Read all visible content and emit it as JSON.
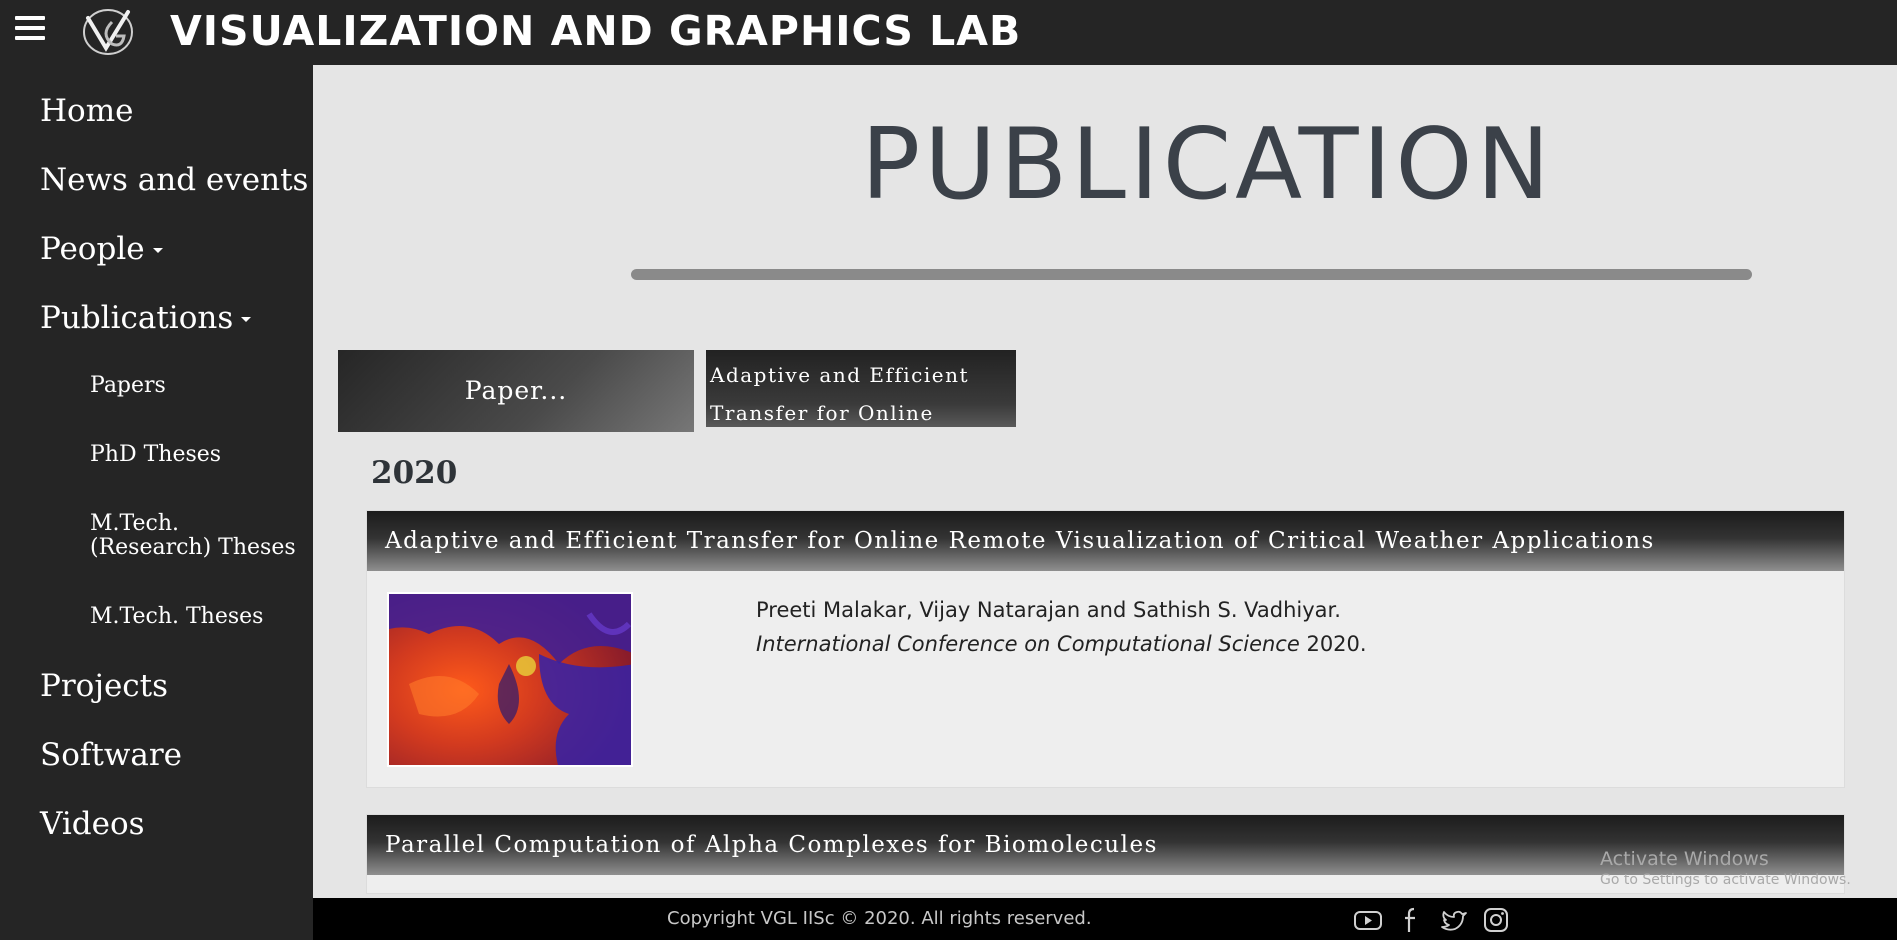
{
  "header": {
    "menu_icon": "hamburger-icon",
    "logo": "vgl-logo",
    "lab_title": "VISUALIZATION AND GRAPHICS LAB"
  },
  "sidebar": {
    "items": [
      {
        "label": "Home"
      },
      {
        "label": "News and events"
      },
      {
        "label": "People"
      },
      {
        "label": "Publications"
      },
      {
        "label": "Papers"
      },
      {
        "label": "PhD Theses"
      },
      {
        "label": "M.Tech. (Research) Theses"
      },
      {
        "label": "M.Tech. Theses"
      },
      {
        "label": "Projects"
      },
      {
        "label": "Software"
      },
      {
        "label": "Videos"
      }
    ]
  },
  "main": {
    "page_title": "PUBLICATION",
    "filter_button": "Paper...",
    "search_text": "Adaptive and Efficient Transfer for Online Remote",
    "year": "2020",
    "publications": [
      {
        "title": "Adaptive and Efficient Transfer for Online Remote Visualization of Critical Weather Applications",
        "authors": "Preeti Malakar, Vijay Natarajan and Sathish S. Vadhiyar.",
        "venue": "International Conference on Computational Science",
        "venue_year": "2020."
      },
      {
        "title": "Parallel Computation of Alpha Complexes for Biomolecules"
      }
    ]
  },
  "watermark": {
    "line1": "Activate Windows",
    "line2": "Go to Settings to activate Windows."
  },
  "footer": {
    "copyright": "Copyright VGL IISc © 2020. All rights reserved.",
    "social_icons": [
      "youtube-icon",
      "facebook-icon",
      "twitter-icon",
      "instagram-icon"
    ]
  },
  "colors": {
    "header_bg": "#252525",
    "sidebar_bg": "#252525",
    "page_bg": "#e5e5e5",
    "card_bg": "#eeeeee",
    "footer_bg": "#000000",
    "title_color": "#3b4149"
  }
}
